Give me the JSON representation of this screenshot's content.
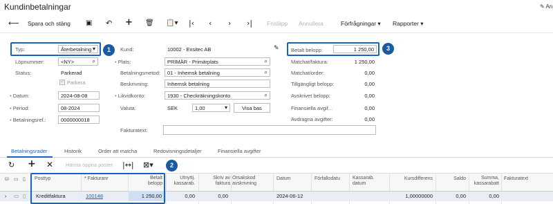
{
  "window": {
    "title": "Kundinbetalningar",
    "top_right_label": "An"
  },
  "toolbar": {
    "back_icon": "arrow-left-icon",
    "save_close": "Spara och stäng",
    "save_icon": "floppy-disk-icon",
    "undo_icon": "undo-icon",
    "add_icon": "plus-icon",
    "delete_icon": "trash-icon",
    "copy_icon": "clipboard-icon",
    "first_icon": "first-record-icon",
    "prev_icon": "chevron-left-icon",
    "next_icon": "chevron-right-icon",
    "last_icon": "last-record-icon",
    "release": "Frisläpp",
    "cancel": "Annullera",
    "inquiries": "Förfrågningar",
    "reports": "Rapporter"
  },
  "form": {
    "typ": {
      "label": "Typ:",
      "value": "Återbetalning"
    },
    "lopnummer": {
      "label": "Löpnummer:",
      "value": "<NY>"
    },
    "status": {
      "label": "Status:",
      "value": "Parkerad"
    },
    "parkera": {
      "label": "Parkera"
    },
    "datum": {
      "label": "Datum:",
      "value": "2024-08-08"
    },
    "period": {
      "label": "Period:",
      "value": "08-2024"
    },
    "betalningsref": {
      "label": "Betalningsref.:",
      "value": "0000000018"
    },
    "kund": {
      "label": "Kund:",
      "value": "10002 - Exsitec AB"
    },
    "plats": {
      "label": "Plats:",
      "value": "PRIMÄR - Primärplats"
    },
    "betalningsmetod": {
      "label": "Betalningsmetod:",
      "value": "01 - Inhemsk betalning"
    },
    "beskrivning": {
      "label": "Beskrivning:",
      "value": "Inhemsk betalning"
    },
    "likvidkonto": {
      "label": "Likvidkonto:",
      "value": "1930 - Checkräkningskonto"
    },
    "valuta": {
      "label": "Valuta:",
      "code": "SEK",
      "rate": "1,00",
      "view_base": "Visa bas"
    },
    "fakturatext": {
      "label": "Fakturatext:",
      "value": ""
    }
  },
  "amounts": {
    "betalt": {
      "label": "Betalt belopp:",
      "value": "1 250,00"
    },
    "matchat_faktura": {
      "label": "Matchat/faktura:",
      "value": "1 250,00"
    },
    "matchat_order": {
      "label": "Matchat/order:",
      "value": "0,00"
    },
    "tillgangligt": {
      "label": "Tillgängligt belopp:",
      "value": "0,00"
    },
    "avskrivet": {
      "label": "Avskrivet belopp:",
      "value": "0,00"
    },
    "finansiella": {
      "label": "Finansiella avgif...",
      "value": "0,00"
    },
    "avdragna": {
      "label": "Avdragna avgifter:",
      "value": "0,00"
    }
  },
  "callouts": [
    "1",
    "2",
    "3"
  ],
  "tabs": [
    "Betalningsrader",
    "Historik",
    "Order att matcha",
    "Redovisningsdetaljer",
    "Finansiella avgifter"
  ],
  "grid_toolbar": {
    "refresh_icon": "refresh-icon",
    "add_icon": "plus-icon",
    "delete_icon": "close-icon",
    "fetch_open": "Hämta öppna poster",
    "fit_icon": "fit-columns-icon",
    "excel_icon": "excel-export-icon"
  },
  "grid": {
    "headers": {
      "posttyp": "Posttyp",
      "fakturanr": "Fakturanr",
      "betalt_belopp": [
        "Betalt",
        "belopp"
      ],
      "utnyttj": [
        "Utnyttj.",
        "kassarab."
      ],
      "skriv_av": [
        "Skriv av",
        "faktura"
      ],
      "orsakskod": [
        "Orsakskod",
        "avskrivning"
      ],
      "datum": "Datum",
      "forfallodat": "Förfallodatu",
      "kassarab_datum": [
        "Kassarab.",
        "datum"
      ],
      "kursdifferens": "Kursdifferens",
      "saldo": "Saldo",
      "summa": [
        "Summa,",
        "kassarabatt"
      ],
      "fakturatext": "Fakturatext"
    },
    "rows": [
      {
        "posttyp": "Kreditfaktura",
        "fakturanr": "100148",
        "betalt": "1 250,00",
        "utnyttj": "0,00",
        "skriv_av": "0,00",
        "datum": "2024-06-12",
        "kursdiff": "1,00000000",
        "saldo": "0,00",
        "summa": "0,00"
      }
    ]
  }
}
